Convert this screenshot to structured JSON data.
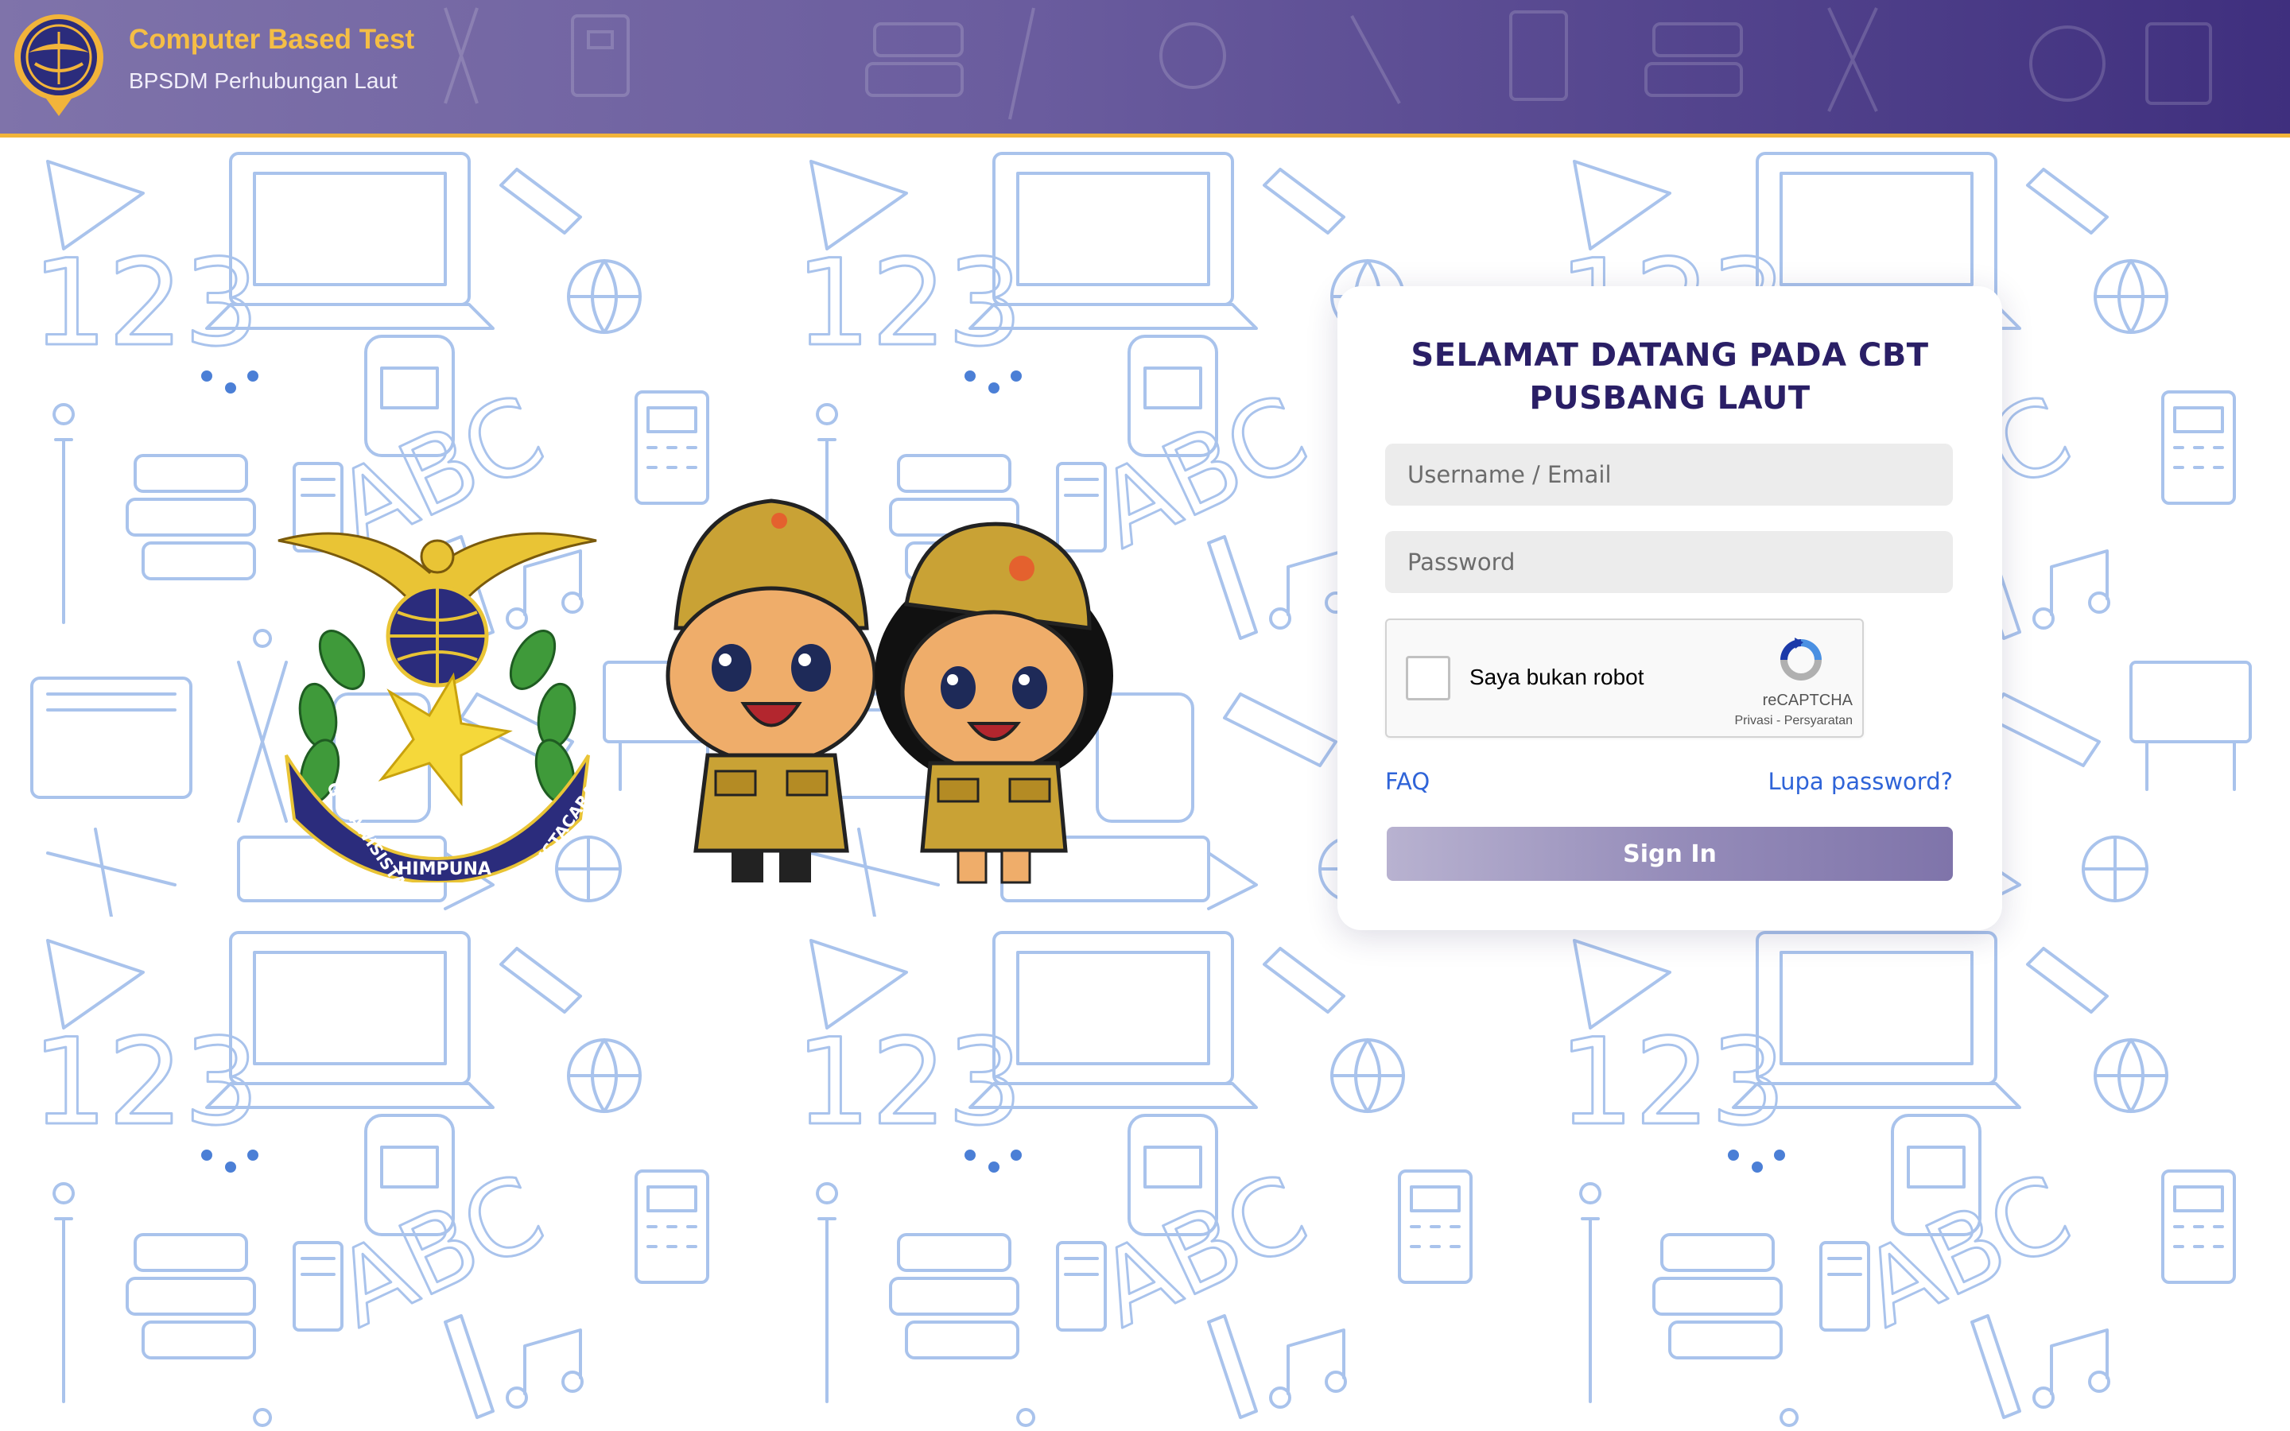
{
  "header": {
    "title": "Computer Based Test",
    "subtitle": "BPSDM Perhubungan Laut",
    "logo_icon": "ministry-of-transportation-logo-icon",
    "accent_color": "#f2b43a",
    "title_color": "#f5be45"
  },
  "emblem": {
    "icon": "pusbang-laut-emblem-icon",
    "ribbon_text": [
      "GUNAWISISTA",
      "HIMPUNA",
      "SISTACARA"
    ]
  },
  "mascots": [
    "male-cadet-mascot",
    "female-cadet-mascot"
  ],
  "login": {
    "title": "SELAMAT DATANG PADA CBT PUSBANG LAUT",
    "username_placeholder": "Username / Email",
    "password_placeholder": "Password",
    "captcha": {
      "label": "Saya bukan robot",
      "brand": "reCAPTCHA",
      "privacy": "Privasi",
      "separator": " - ",
      "terms": "Persyaratan"
    },
    "faq_label": "FAQ",
    "forgot_label": "Lupa password?",
    "signin_label": "Sign In",
    "title_color": "#2a1f66",
    "link_color": "#2f64d8"
  }
}
